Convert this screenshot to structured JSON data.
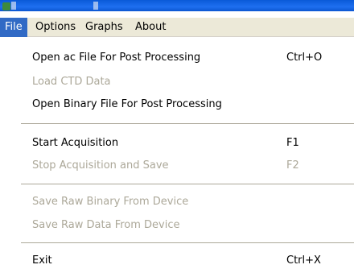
{
  "menubar": {
    "items": [
      {
        "label": "File",
        "active": true
      },
      {
        "label": "Options"
      },
      {
        "label": "Graphs"
      },
      {
        "label": "About"
      }
    ]
  },
  "file_menu": {
    "items": [
      {
        "label": "Open ac File For Post Processing",
        "shortcut": "Ctrl+O",
        "enabled": true
      },
      {
        "label": "Load CTD Data",
        "shortcut": "",
        "enabled": false
      },
      {
        "label": "Open Binary File For Post Processing",
        "shortcut": "",
        "enabled": true
      },
      {
        "label": "Start Acquisition",
        "shortcut": "F1",
        "enabled": true
      },
      {
        "label": "Stop Acquisition and Save",
        "shortcut": "F2",
        "enabled": false
      },
      {
        "label": "Save Raw Binary From Device",
        "shortcut": "",
        "enabled": false
      },
      {
        "label": "Save Raw Data From Device",
        "shortcut": "",
        "enabled": false
      },
      {
        "label": "Exit",
        "shortcut": "Ctrl+X",
        "enabled": true
      }
    ]
  },
  "colors": {
    "highlight": "#316ac5",
    "disabled_text": "#aca899",
    "menubar_bg": "#ece9d8"
  }
}
